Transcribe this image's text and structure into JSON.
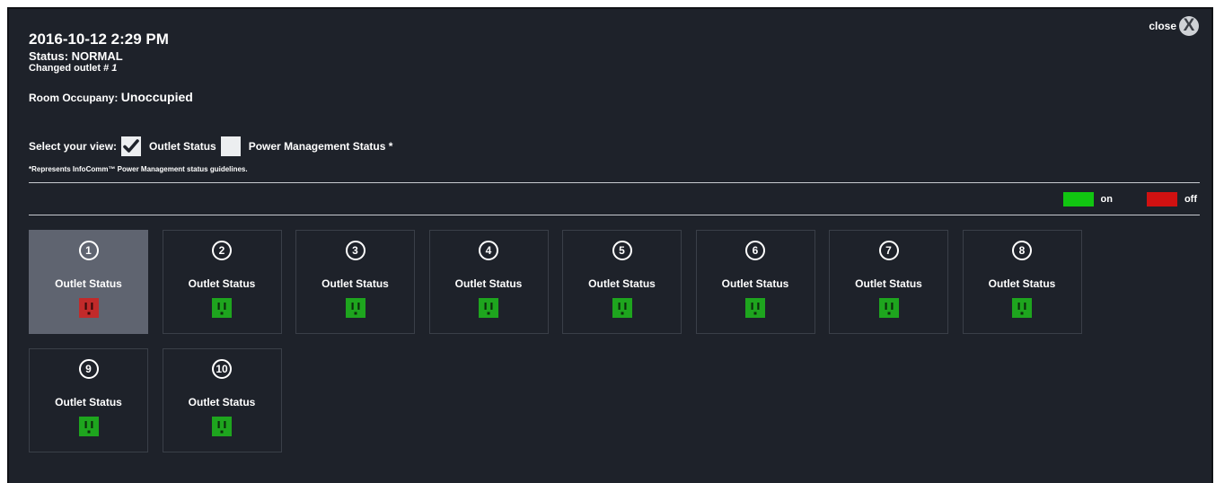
{
  "header": {
    "datetime": "2016-10-12 2:29 PM",
    "status_text": "Status: NORMAL",
    "changed_prefix": "Changed outlet #",
    "changed_outlet": "1",
    "occupancy_label": "Room Occupany:",
    "occupancy_value": "Unoccupied"
  },
  "close": {
    "label": "close",
    "icon": "X"
  },
  "view": {
    "label": "Select your view:",
    "options": [
      {
        "label": "Outlet Status",
        "checked": true
      },
      {
        "label": "Power Management Status *",
        "checked": false
      }
    ],
    "note": "*Represents InfoComm™ Power Management status guidelines."
  },
  "legend": {
    "on_label": "on",
    "on_color": "#11c511",
    "off_label": "off",
    "off_color": "#d11111"
  },
  "outlets": [
    {
      "number": "1",
      "label": "Outlet Status",
      "state": "off",
      "selected": true
    },
    {
      "number": "2",
      "label": "Outlet Status",
      "state": "on",
      "selected": false
    },
    {
      "number": "3",
      "label": "Outlet Status",
      "state": "on",
      "selected": false
    },
    {
      "number": "4",
      "label": "Outlet Status",
      "state": "on",
      "selected": false
    },
    {
      "number": "5",
      "label": "Outlet Status",
      "state": "on",
      "selected": false
    },
    {
      "number": "6",
      "label": "Outlet Status",
      "state": "on",
      "selected": false
    },
    {
      "number": "7",
      "label": "Outlet Status",
      "state": "on",
      "selected": false
    },
    {
      "number": "8",
      "label": "Outlet Status",
      "state": "on",
      "selected": false
    },
    {
      "number": "9",
      "label": "Outlet Status",
      "state": "on",
      "selected": false
    },
    {
      "number": "10",
      "label": "Outlet Status",
      "state": "on",
      "selected": false
    }
  ],
  "colors": {
    "plug_on": "#1ea51e",
    "plug_off": "#c12a2a",
    "plug_slot": "#0c2e0c"
  }
}
